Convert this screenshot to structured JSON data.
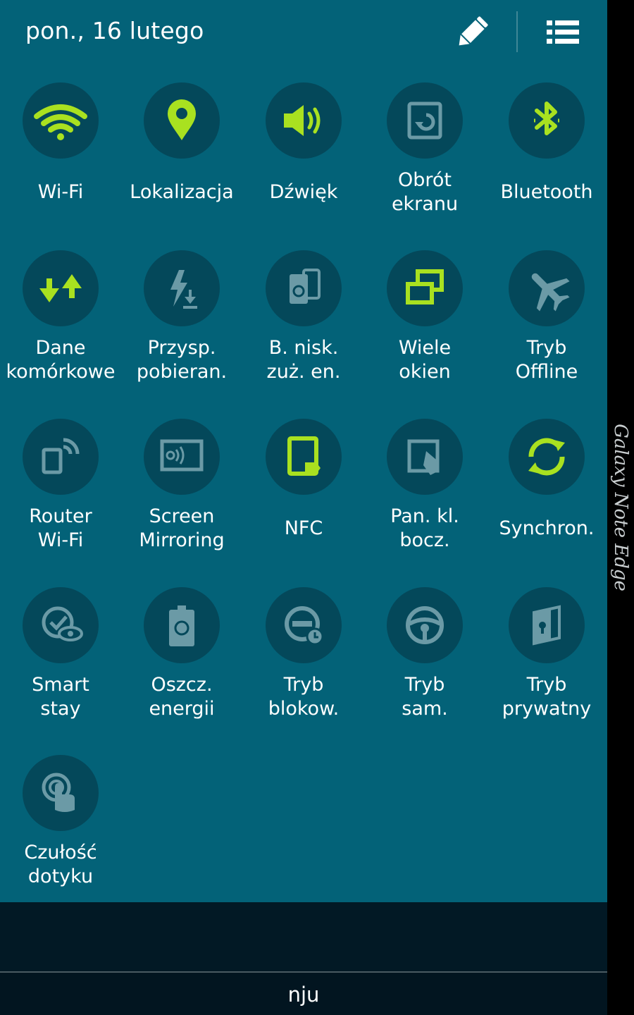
{
  "header": {
    "date": "pon., 16 lutego"
  },
  "colors": {
    "panel_bg": "#036278",
    "circle_bg": "#04485a",
    "icon_active": "#a9e120",
    "icon_inactive": "#6b9aa6"
  },
  "tiles": [
    {
      "label": "Wi-Fi",
      "icon": "wifi-icon",
      "active": true
    },
    {
      "label": "Lokalizacja",
      "icon": "location-pin-icon",
      "active": true
    },
    {
      "label": "Dźwięk",
      "icon": "speaker-icon",
      "active": true
    },
    {
      "label": "Obrót\nekranu",
      "icon": "screen-rotation-icon",
      "active": false
    },
    {
      "label": "Bluetooth",
      "icon": "bluetooth-icon",
      "active": true
    },
    {
      "label": "Dane\nkomórkowe",
      "icon": "mobile-data-icon",
      "active": true
    },
    {
      "label": "Przysp.\npobieran.",
      "icon": "download-booster-icon",
      "active": false
    },
    {
      "label": "B. nisk.\nzuż. en.",
      "icon": "ultra-power-saving-icon",
      "active": false
    },
    {
      "label": "Wiele\nokien",
      "icon": "multi-window-icon",
      "active": true
    },
    {
      "label": "Tryb\nOffline",
      "icon": "airplane-icon",
      "active": false
    },
    {
      "label": "Router\nWi-Fi",
      "icon": "wifi-hotspot-icon",
      "active": false
    },
    {
      "label": "Screen\nMirroring",
      "icon": "screen-mirroring-icon",
      "active": false
    },
    {
      "label": "NFC",
      "icon": "nfc-icon",
      "active": true
    },
    {
      "label": "Pan. kl.\nbocz.",
      "icon": "edge-screen-icon",
      "active": false
    },
    {
      "label": "Synchron.",
      "icon": "sync-icon",
      "active": true
    },
    {
      "label": "Smart\nstay",
      "icon": "smart-stay-eye-icon",
      "active": false
    },
    {
      "label": "Oszcz.\nenergii",
      "icon": "power-saving-battery-icon",
      "active": false
    },
    {
      "label": "Tryb\nblokow.",
      "icon": "blocking-mode-icon",
      "active": false
    },
    {
      "label": "Tryb\nsam.",
      "icon": "steering-wheel-icon",
      "active": false
    },
    {
      "label": "Tryb\nprywatny",
      "icon": "private-mode-lock-icon",
      "active": false
    },
    {
      "label": "Czułość\ndotyku",
      "icon": "touch-sensitivity-icon",
      "active": false
    }
  ],
  "carrier": "nju",
  "edge_label": "Galaxy Note Edge"
}
